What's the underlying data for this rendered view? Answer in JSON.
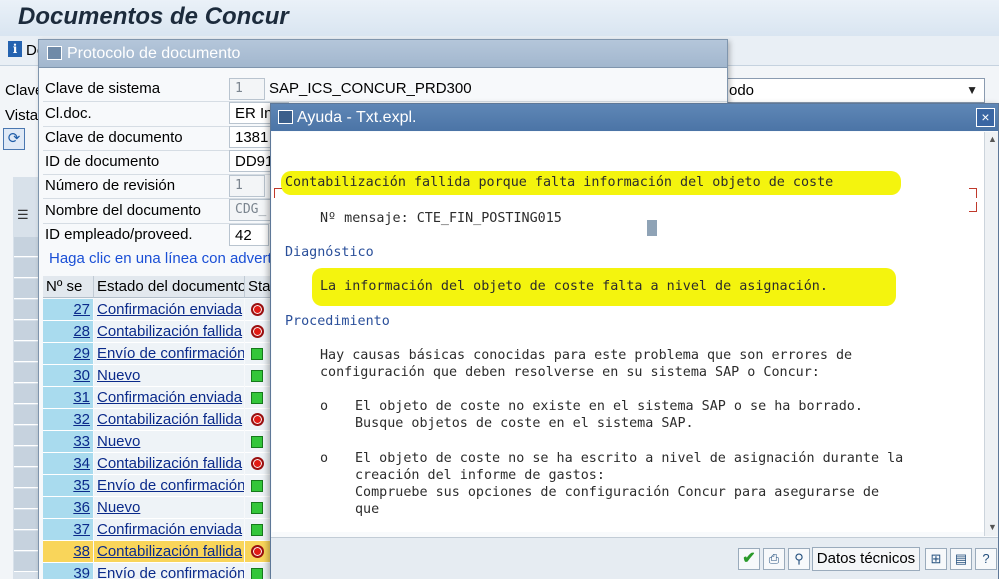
{
  "app": {
    "title": "Documentos de Concur",
    "toolbar_info_label": "Do",
    "label_clave": "Clave",
    "label_vista": "Vista",
    "view_select_value": "odo"
  },
  "protocol_window": {
    "title": "Protocolo de documento",
    "fields": [
      {
        "label": "Clave de sistema",
        "box": "1",
        "value": "SAP_ICS_CONCUR_PRD300"
      },
      {
        "label": "Cl.doc.",
        "box": "ER In",
        "value": ""
      },
      {
        "label": "Clave de documento",
        "box": "1381",
        "value": ""
      },
      {
        "label": "ID de documento",
        "box": "DD91",
        "value": ""
      },
      {
        "label": "Número de revisión",
        "box": "1",
        "value": ""
      },
      {
        "label": "Nombre del documento",
        "box": "CDG_",
        "value": ""
      },
      {
        "label": "ID empleado/proveed.",
        "box": "42",
        "value": ""
      }
    ],
    "hint": "Haga clic en una línea con adverte",
    "table": {
      "headers": [
        "Nº se",
        "Estado del documento",
        "Stat"
      ],
      "rows": [
        {
          "num": "27",
          "state": "Confirmación enviada",
          "status": "red"
        },
        {
          "num": "28",
          "state": "Contabilización fallida",
          "status": "red"
        },
        {
          "num": "29",
          "state": "Envío de confirmación",
          "status": "green"
        },
        {
          "num": "30",
          "state": "Nuevo",
          "status": "green"
        },
        {
          "num": "31",
          "state": "Confirmación enviada",
          "status": "green"
        },
        {
          "num": "32",
          "state": "Contabilización fallida",
          "status": "red"
        },
        {
          "num": "33",
          "state": "Nuevo",
          "status": "green"
        },
        {
          "num": "34",
          "state": "Contabilización fallida",
          "status": "red"
        },
        {
          "num": "35",
          "state": "Envío de confirmación",
          "status": "green"
        },
        {
          "num": "36",
          "state": "Nuevo",
          "status": "green"
        },
        {
          "num": "37",
          "state": "Confirmación enviada",
          "status": "green"
        },
        {
          "num": "38",
          "state": "Contabilización fallida",
          "status": "red",
          "selected": true
        },
        {
          "num": "39",
          "state": "Envío de confirmación",
          "status": "green"
        }
      ]
    }
  },
  "help_dialog": {
    "title": "Ayuda - Txt.expl.",
    "close_label": "×",
    "heading": "Contabilización fallida porque falta información del objeto de coste",
    "message_no": "Nº mensaje: CTE_FIN_POSTING015",
    "diagnostico_title": "Diagnóstico",
    "diagnostico_text": "La información del objeto de coste falta a nivel de asignación.",
    "procedimiento_title": "Procedimiento",
    "procedimiento_lines": [
      "Hay causas básicas conocidas para este problema que son errores de",
      "configuración que deben resolverse en su sistema SAP o Concur:"
    ],
    "bullet1_lines": [
      "El objeto de coste no existe en el sistema SAP o se ha borrado.",
      "Busque objetos de coste en el sistema SAP."
    ],
    "bullet2_lines": [
      "El objeto de coste no se ha escrito a nivel de asignación durante la",
      "creación del informe de gastos:",
      "Compruebe sus opciones de configuración Concur para asegurarse de",
      "que"
    ],
    "bullet_char": "o",
    "footer": {
      "tech_button": "Datos técnicos"
    }
  },
  "colors": {
    "highlight": "#f4f40e",
    "selected_row": "#f9d55a",
    "number_cell": "#a9dbee",
    "status_red": "#e21b14",
    "status_green": "#33c63a"
  }
}
